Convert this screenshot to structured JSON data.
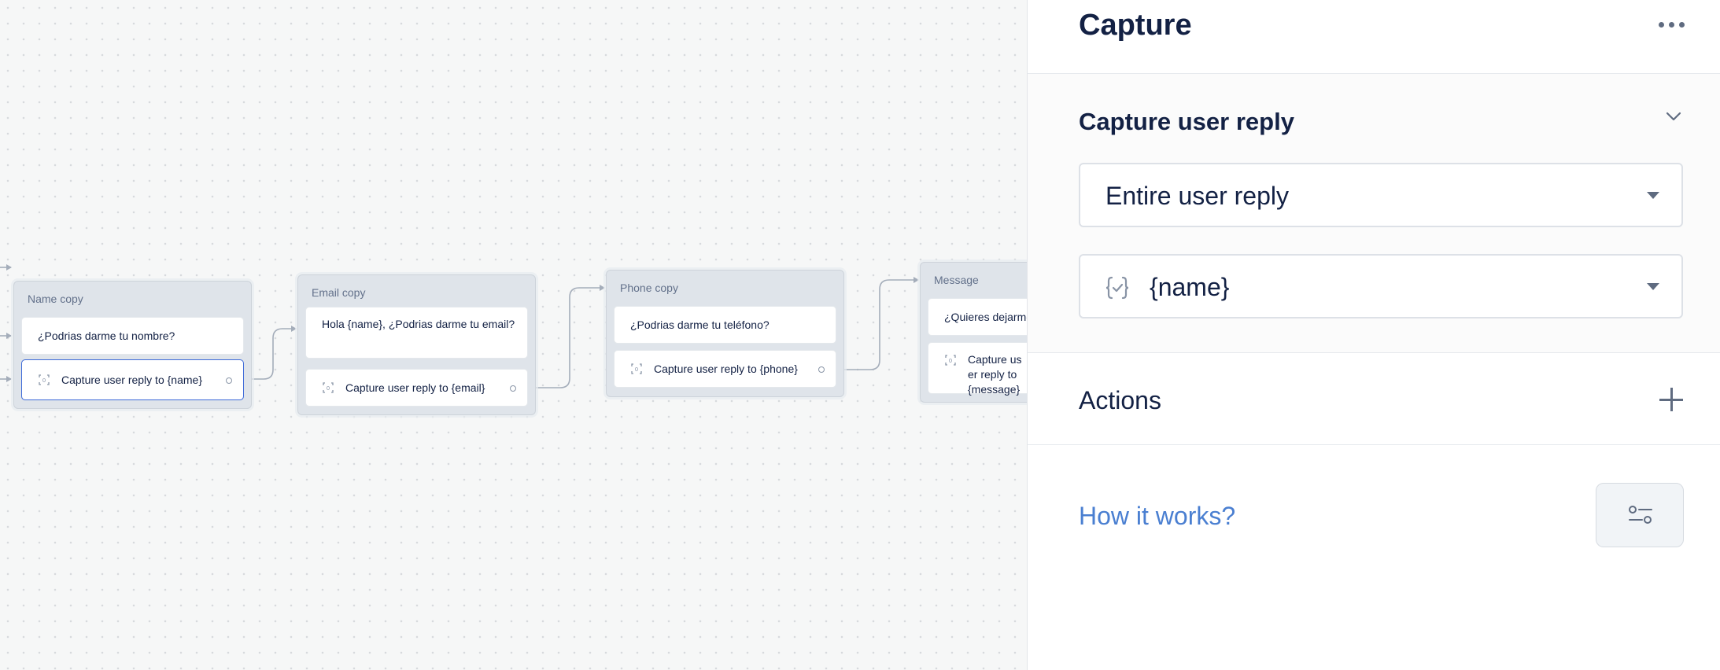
{
  "canvas": {
    "blocks": [
      {
        "title": "Name copy",
        "steps": [
          {
            "type": "text",
            "text": "¿Podrias darme tu nombre?"
          },
          {
            "type": "capture",
            "text": "Capture user reply to {name}",
            "selected": true
          }
        ]
      },
      {
        "title": "Email copy",
        "steps": [
          {
            "type": "text",
            "text": "Hola {name}, ¿Podrias darme tu email?"
          },
          {
            "type": "capture",
            "text": "Capture user reply to {email}"
          }
        ]
      },
      {
        "title": "Phone copy",
        "steps": [
          {
            "type": "text",
            "text": "¿Podrias darme tu teléfono?"
          },
          {
            "type": "capture",
            "text": "Capture user reply to {phone}"
          }
        ]
      },
      {
        "title": "Message",
        "steps": [
          {
            "type": "text",
            "text": "¿Quieres dejarme"
          },
          {
            "type": "capture",
            "text": "Capture user reply to {message}"
          }
        ]
      }
    ]
  },
  "panel": {
    "title": "Capture",
    "more_icon": "more-horizontal-icon",
    "capture_section": {
      "title": "Capture user reply",
      "reply_select": "Entire user reply",
      "variable_select": "{name}",
      "variable_icon": "variable-braces-icon"
    },
    "actions": {
      "title": "Actions",
      "add_icon": "plus-icon"
    },
    "how_it_works": "How it works?",
    "settings_icon": "sliders-icon"
  },
  "colors": {
    "accent": "#3d6ad8",
    "link": "#4a7fd1",
    "text": "#132144",
    "block_bg": "#dfe4ea"
  }
}
